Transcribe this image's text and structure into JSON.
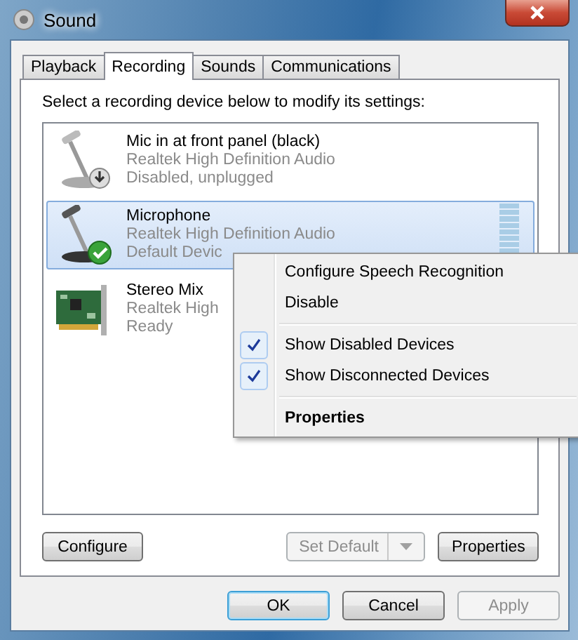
{
  "window": {
    "title": "Sound"
  },
  "tabs": [
    {
      "label": "Playback",
      "selected": false
    },
    {
      "label": "Recording",
      "selected": true
    },
    {
      "label": "Sounds",
      "selected": false
    },
    {
      "label": "Communications",
      "selected": false
    }
  ],
  "instruction": "Select a recording device below to modify its settings:",
  "devices": [
    {
      "kind": "unplugged_mic",
      "name": "Mic in at front panel (black)",
      "driver": "Realtek High Definition Audio",
      "status": "Disabled, unplugged",
      "selected": false
    },
    {
      "kind": "default_mic",
      "name": "Microphone",
      "driver": "Realtek High Definition Audio",
      "status": "Default Devic",
      "selected": true
    },
    {
      "kind": "sound_card",
      "name": "Stereo Mix",
      "driver": "Realtek High",
      "status": "Ready",
      "selected": false
    }
  ],
  "context_menu": [
    [
      {
        "label": "Configure Speech Recognition",
        "checked": false,
        "default": false
      },
      {
        "label": "Disable",
        "checked": false,
        "default": false
      }
    ],
    [
      {
        "label": "Show Disabled Devices",
        "checked": true,
        "default": false
      },
      {
        "label": "Show Disconnected Devices",
        "checked": true,
        "default": false
      }
    ],
    [
      {
        "label": "Properties",
        "checked": false,
        "default": true
      }
    ]
  ],
  "panel_buttons": [
    {
      "kind": "button",
      "label": "Configure",
      "disabled": false
    },
    {
      "kind": "split",
      "label": "Set Default",
      "disabled": true
    },
    {
      "kind": "button",
      "label": "Properties",
      "disabled": false
    }
  ],
  "dialog_buttons": [
    {
      "label": "OK",
      "disabled": false,
      "default": true
    },
    {
      "label": "Cancel",
      "disabled": false,
      "default": false
    },
    {
      "label": "Apply",
      "disabled": true,
      "default": false
    }
  ]
}
